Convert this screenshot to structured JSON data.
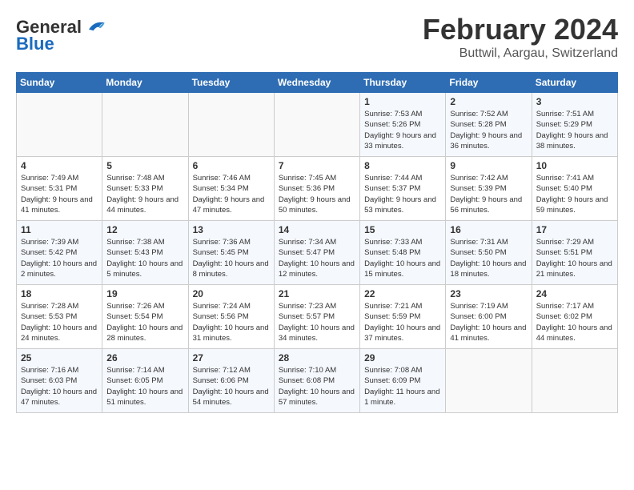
{
  "header": {
    "logo_general": "General",
    "logo_blue": "Blue",
    "month_title": "February 2024",
    "location": "Buttwil, Aargau, Switzerland"
  },
  "calendar": {
    "days_of_week": [
      "Sunday",
      "Monday",
      "Tuesday",
      "Wednesday",
      "Thursday",
      "Friday",
      "Saturday"
    ],
    "weeks": [
      [
        {
          "day": "",
          "info": ""
        },
        {
          "day": "",
          "info": ""
        },
        {
          "day": "",
          "info": ""
        },
        {
          "day": "",
          "info": ""
        },
        {
          "day": "1",
          "info": "Sunrise: 7:53 AM\nSunset: 5:26 PM\nDaylight: 9 hours and 33 minutes."
        },
        {
          "day": "2",
          "info": "Sunrise: 7:52 AM\nSunset: 5:28 PM\nDaylight: 9 hours and 36 minutes."
        },
        {
          "day": "3",
          "info": "Sunrise: 7:51 AM\nSunset: 5:29 PM\nDaylight: 9 hours and 38 minutes."
        }
      ],
      [
        {
          "day": "4",
          "info": "Sunrise: 7:49 AM\nSunset: 5:31 PM\nDaylight: 9 hours and 41 minutes."
        },
        {
          "day": "5",
          "info": "Sunrise: 7:48 AM\nSunset: 5:33 PM\nDaylight: 9 hours and 44 minutes."
        },
        {
          "day": "6",
          "info": "Sunrise: 7:46 AM\nSunset: 5:34 PM\nDaylight: 9 hours and 47 minutes."
        },
        {
          "day": "7",
          "info": "Sunrise: 7:45 AM\nSunset: 5:36 PM\nDaylight: 9 hours and 50 minutes."
        },
        {
          "day": "8",
          "info": "Sunrise: 7:44 AM\nSunset: 5:37 PM\nDaylight: 9 hours and 53 minutes."
        },
        {
          "day": "9",
          "info": "Sunrise: 7:42 AM\nSunset: 5:39 PM\nDaylight: 9 hours and 56 minutes."
        },
        {
          "day": "10",
          "info": "Sunrise: 7:41 AM\nSunset: 5:40 PM\nDaylight: 9 hours and 59 minutes."
        }
      ],
      [
        {
          "day": "11",
          "info": "Sunrise: 7:39 AM\nSunset: 5:42 PM\nDaylight: 10 hours and 2 minutes."
        },
        {
          "day": "12",
          "info": "Sunrise: 7:38 AM\nSunset: 5:43 PM\nDaylight: 10 hours and 5 minutes."
        },
        {
          "day": "13",
          "info": "Sunrise: 7:36 AM\nSunset: 5:45 PM\nDaylight: 10 hours and 8 minutes."
        },
        {
          "day": "14",
          "info": "Sunrise: 7:34 AM\nSunset: 5:47 PM\nDaylight: 10 hours and 12 minutes."
        },
        {
          "day": "15",
          "info": "Sunrise: 7:33 AM\nSunset: 5:48 PM\nDaylight: 10 hours and 15 minutes."
        },
        {
          "day": "16",
          "info": "Sunrise: 7:31 AM\nSunset: 5:50 PM\nDaylight: 10 hours and 18 minutes."
        },
        {
          "day": "17",
          "info": "Sunrise: 7:29 AM\nSunset: 5:51 PM\nDaylight: 10 hours and 21 minutes."
        }
      ],
      [
        {
          "day": "18",
          "info": "Sunrise: 7:28 AM\nSunset: 5:53 PM\nDaylight: 10 hours and 24 minutes."
        },
        {
          "day": "19",
          "info": "Sunrise: 7:26 AM\nSunset: 5:54 PM\nDaylight: 10 hours and 28 minutes."
        },
        {
          "day": "20",
          "info": "Sunrise: 7:24 AM\nSunset: 5:56 PM\nDaylight: 10 hours and 31 minutes."
        },
        {
          "day": "21",
          "info": "Sunrise: 7:23 AM\nSunset: 5:57 PM\nDaylight: 10 hours and 34 minutes."
        },
        {
          "day": "22",
          "info": "Sunrise: 7:21 AM\nSunset: 5:59 PM\nDaylight: 10 hours and 37 minutes."
        },
        {
          "day": "23",
          "info": "Sunrise: 7:19 AM\nSunset: 6:00 PM\nDaylight: 10 hours and 41 minutes."
        },
        {
          "day": "24",
          "info": "Sunrise: 7:17 AM\nSunset: 6:02 PM\nDaylight: 10 hours and 44 minutes."
        }
      ],
      [
        {
          "day": "25",
          "info": "Sunrise: 7:16 AM\nSunset: 6:03 PM\nDaylight: 10 hours and 47 minutes."
        },
        {
          "day": "26",
          "info": "Sunrise: 7:14 AM\nSunset: 6:05 PM\nDaylight: 10 hours and 51 minutes."
        },
        {
          "day": "27",
          "info": "Sunrise: 7:12 AM\nSunset: 6:06 PM\nDaylight: 10 hours and 54 minutes."
        },
        {
          "day": "28",
          "info": "Sunrise: 7:10 AM\nSunset: 6:08 PM\nDaylight: 10 hours and 57 minutes."
        },
        {
          "day": "29",
          "info": "Sunrise: 7:08 AM\nSunset: 6:09 PM\nDaylight: 11 hours and 1 minute."
        },
        {
          "day": "",
          "info": ""
        },
        {
          "day": "",
          "info": ""
        }
      ]
    ]
  }
}
